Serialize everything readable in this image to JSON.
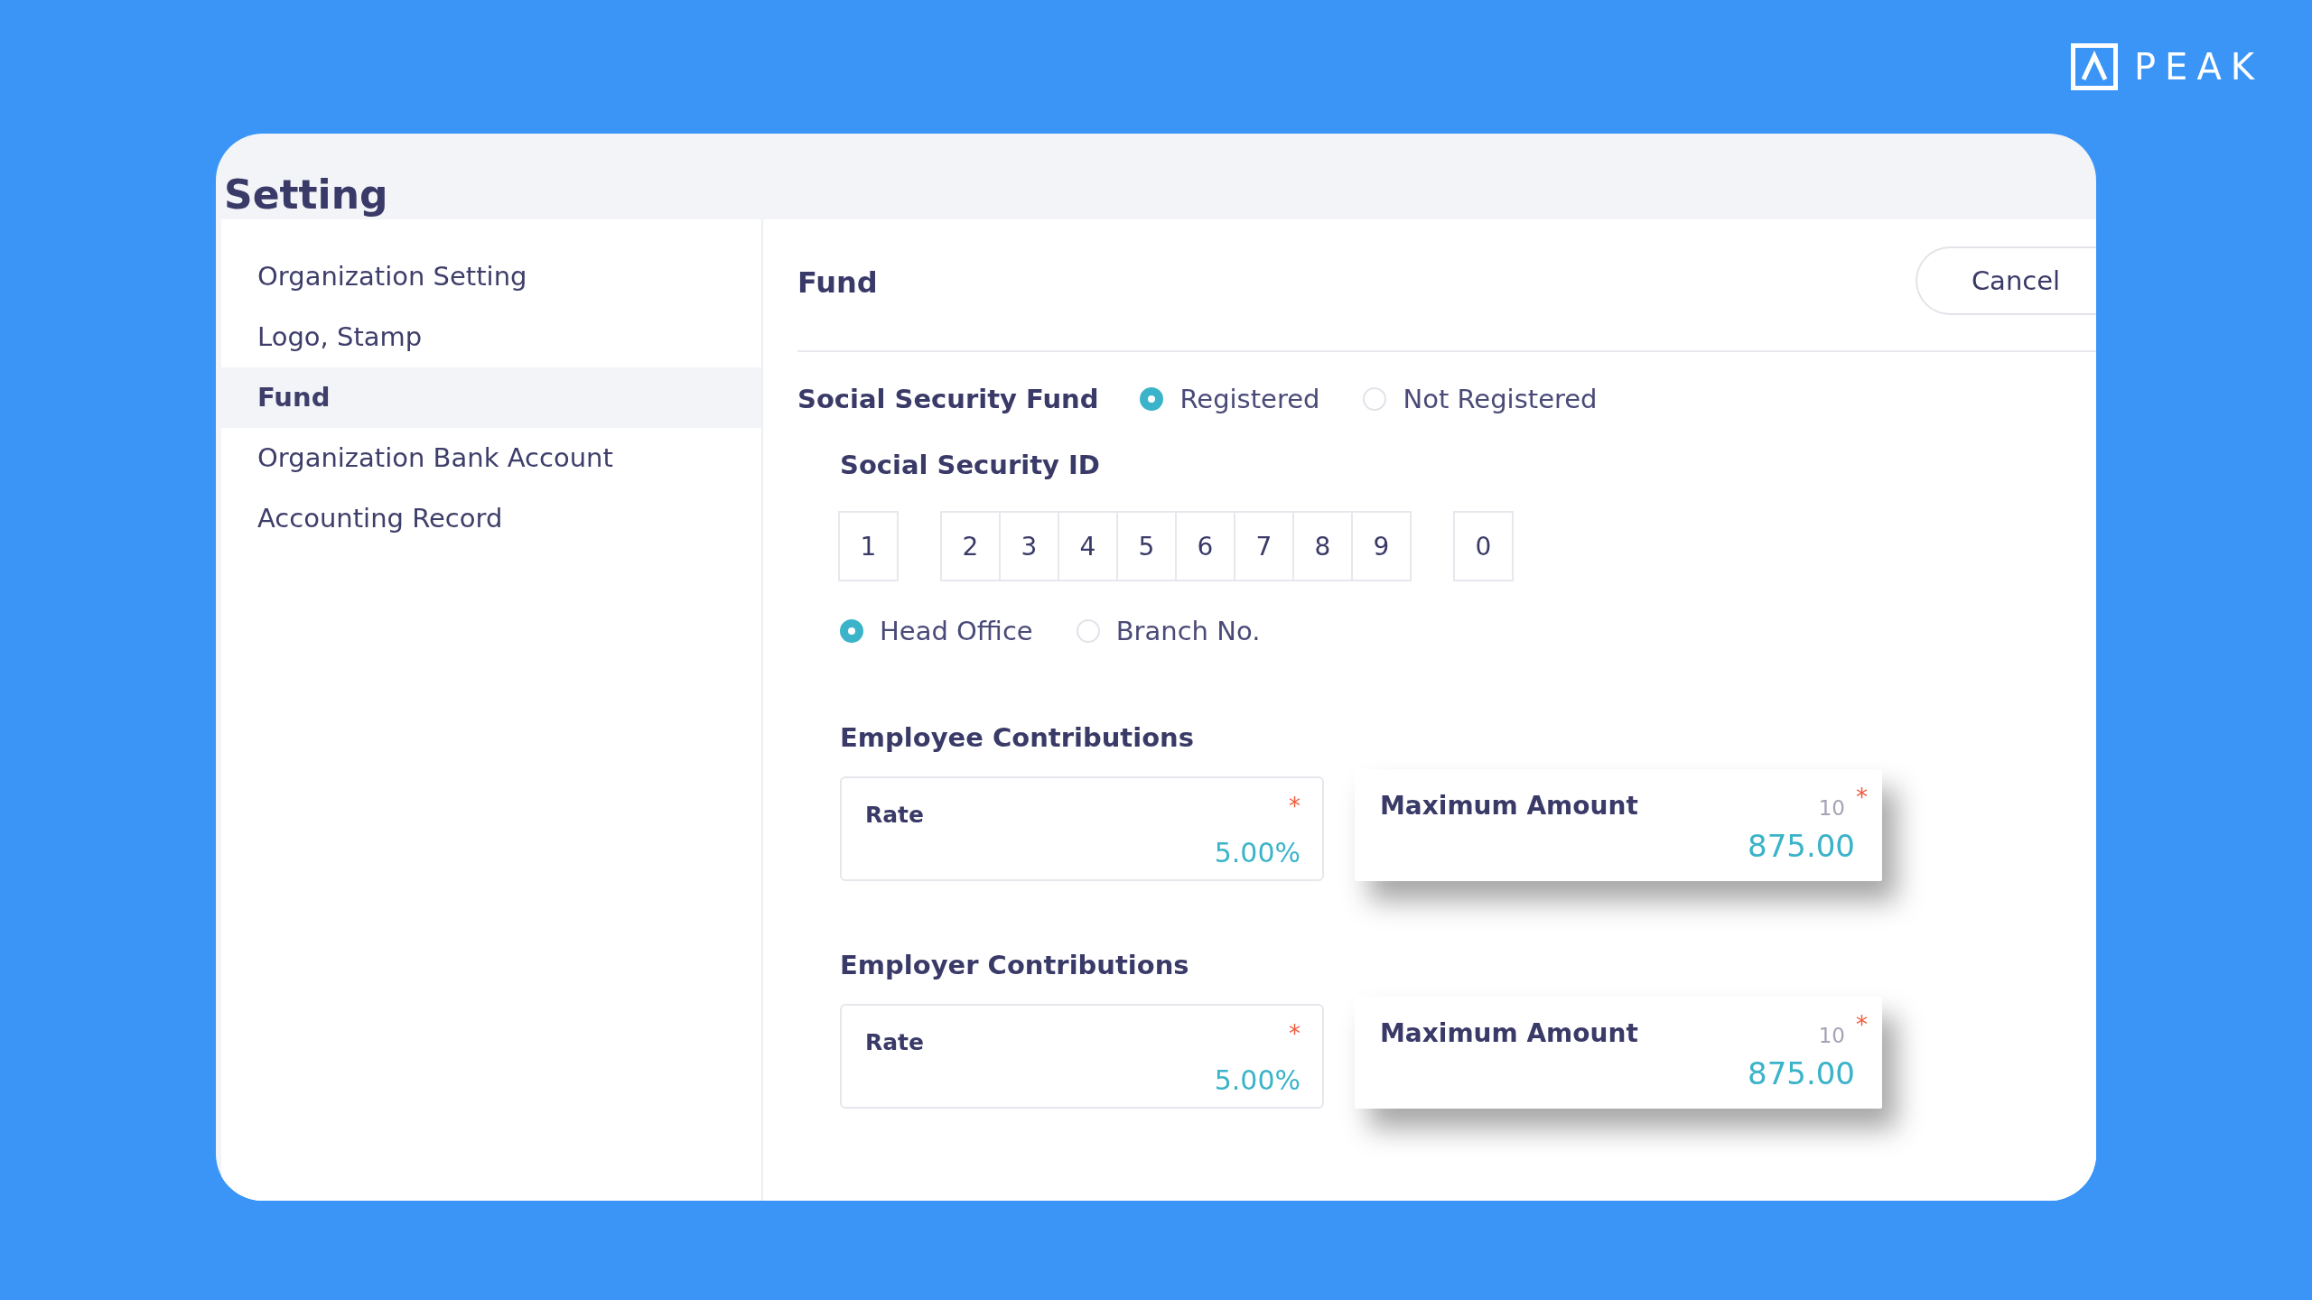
{
  "logo": {
    "text": "PEAK"
  },
  "page": {
    "title": "Setting"
  },
  "sidebar": {
    "items": [
      {
        "label": "Organization Setting",
        "selected": false
      },
      {
        "label": "Logo, Stamp",
        "selected": false
      },
      {
        "label": "Fund",
        "selected": true
      },
      {
        "label": "Organization Bank Account",
        "selected": false
      },
      {
        "label": "Accounting Record",
        "selected": false
      }
    ]
  },
  "panel": {
    "title": "Fund",
    "cancel_button": "Cancel",
    "social_security_fund": {
      "label": "Social Security Fund",
      "options": [
        {
          "label": "Registered",
          "selected": true
        },
        {
          "label": "Not Registered",
          "selected": false
        }
      ]
    },
    "social_security_id": {
      "label": "Social Security ID",
      "groups": [
        [
          "1"
        ],
        [
          "2",
          "3",
          "4",
          "5",
          "6",
          "7",
          "8",
          "9"
        ],
        [
          "0"
        ]
      ]
    },
    "office": {
      "options": [
        {
          "label": "Head Office",
          "selected": true
        },
        {
          "label": "Branch No.",
          "selected": false
        }
      ]
    },
    "contributions": [
      {
        "title": "Employee Contributions",
        "fields": [
          {
            "label": "Rate",
            "value": "5.00%",
            "required_mark": "*",
            "focused": false
          },
          {
            "label": "Maximum Amount",
            "hint": "10",
            "value": "875.00",
            "required_mark": "*",
            "focused": true
          }
        ]
      },
      {
        "title": "Employer Contributions",
        "fields": [
          {
            "label": "Rate",
            "value": "5.00%",
            "required_mark": "*",
            "focused": false
          },
          {
            "label": "Maximum Amount",
            "hint": "10",
            "value": "875.00",
            "required_mark": "*",
            "focused": true
          }
        ]
      }
    ]
  }
}
